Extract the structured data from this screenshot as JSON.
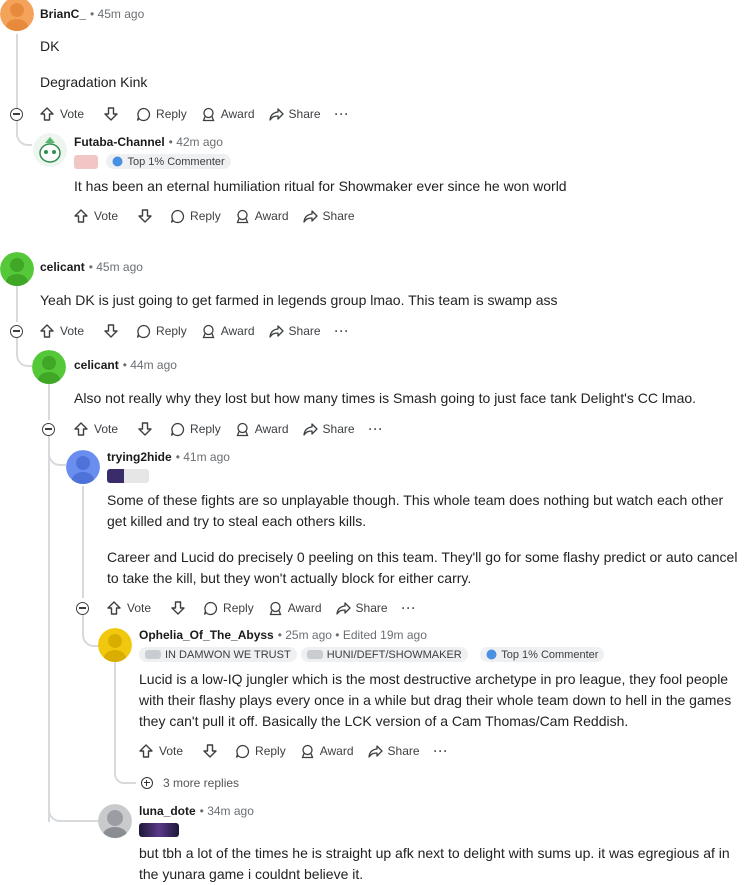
{
  "labels": {
    "vote": "Vote",
    "reply": "Reply",
    "award": "Award",
    "share": "Share",
    "more": "···"
  },
  "comments": [
    {
      "user": "BrianC_",
      "time": "• 45m ago",
      "lines": [
        "DK",
        "Degradation Kink"
      ]
    },
    {
      "user": "Futaba-Channel",
      "time": "• 42m ago",
      "flair": "Top 1% Commenter",
      "lines": [
        "It has been an eternal humiliation ritual for Showmaker ever since he won world"
      ]
    },
    {
      "user": "celicant",
      "time": "• 45m ago",
      "lines": [
        "Yeah DK is just going to get farmed in legends group lmao. This team is swamp ass"
      ]
    },
    {
      "user": "celicant",
      "time": "• 44m ago",
      "lines": [
        "Also not really why they lost but how many times is Smash going to just face tank Delight's CC lmao."
      ]
    },
    {
      "user": "trying2hide",
      "time": "• 41m ago",
      "lines": [
        "Some of these fights are so unplayable though. This whole team does nothing but watch each other get killed and try to steal each others kills.",
        "Career and Lucid do precisely 0 peeling on this team. They'll go for some flashy predict or auto cancel to take the kill, but they won't actually block for either carry."
      ]
    },
    {
      "user": "Ophelia_Of_The_Abyss",
      "time": "• 25m ago • Edited 19m ago",
      "flair1": "IN DAMWON WE TRUST",
      "flair2": "HUNI/DEFT/SHOWMAKER",
      "flair3": "Top 1% Commenter",
      "lines": [
        "Lucid is a low-IQ jungler which is the most destructive archetype in pro league, they fool people with their flashy plays every once in a while but drag their whole team down to hell in the games they can't pull it off. Basically the LCK version of a Cam Thomas/Cam Reddish."
      ]
    },
    {
      "user": "luna_dote",
      "time": "• 34m ago",
      "lines": [
        "but tbh a lot of the times he is straight up afk next to delight with sums up. it was egregious af in the yunara game i couldnt believe it."
      ]
    }
  ],
  "more_replies": "3 more replies",
  "colors": {
    "thread_line": "#d7dadc",
    "avatar_orange": "#f5a35b",
    "avatar_green": "#55c83a",
    "avatar_blue": "#6a8ef0",
    "avatar_yellow": "#f2c80f",
    "avatar_gray": "#c8cacc"
  }
}
